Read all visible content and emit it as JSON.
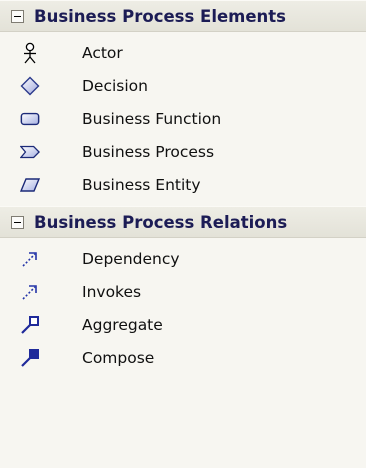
{
  "sections": [
    {
      "title": "Business Process Elements",
      "items": [
        {
          "label": "Actor",
          "icon": "actor-icon"
        },
        {
          "label": "Decision",
          "icon": "decision-icon"
        },
        {
          "label": "Business Function",
          "icon": "business-function-icon"
        },
        {
          "label": "Business Process",
          "icon": "business-process-icon"
        },
        {
          "label": "Business Entity",
          "icon": "business-entity-icon"
        }
      ]
    },
    {
      "title": "Business Process Relations",
      "items": [
        {
          "label": "Dependency",
          "icon": "dependency-icon"
        },
        {
          "label": "Invokes",
          "icon": "invokes-icon"
        },
        {
          "label": "Aggregate",
          "icon": "aggregate-icon"
        },
        {
          "label": "Compose",
          "icon": "compose-icon"
        }
      ]
    }
  ],
  "colors": {
    "background": "#f7f6f1",
    "header_text": "#1c1c55",
    "icon_blue": "#1f2a9a"
  }
}
